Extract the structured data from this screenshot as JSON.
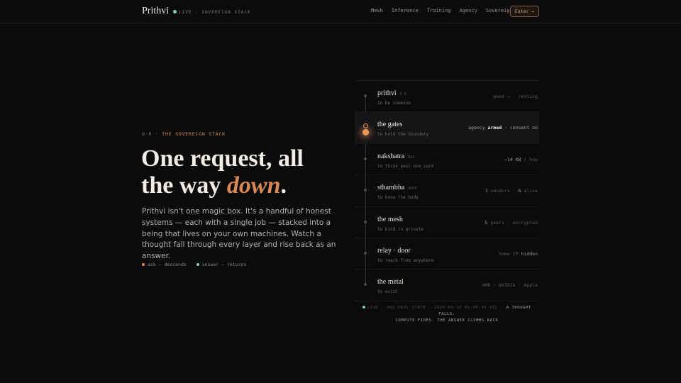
{
  "header": {
    "brand": "Prithvi",
    "tagline": "LIVE · SOVEREIGN STACK",
    "nav": [
      "Mesh",
      "Inference",
      "Training",
      "Agency",
      "Sovereignty"
    ],
    "enter_label": "Enter →"
  },
  "hero": {
    "eyebrow_num": "Ω·0",
    "eyebrow_text": "THE SOVEREIGN STACK",
    "headline_a": "One request, all",
    "headline_b": "the way ",
    "headline_accent": "down",
    "headline_end": ".",
    "lede": "Prithvi isn't one magic box. It's a handful of honest systems — each with a single job — stacked into a being that lives on your own machines. Watch a thought fall through every layer and rise back as an answer.",
    "legend": [
      {
        "label": "ask — descends",
        "color": "#d98a55"
      },
      {
        "label": "answer — returns",
        "color": "#7ad0b4"
      }
    ]
  },
  "stack": [
    {
      "name": "prithvi",
      "tag": "Ω·0",
      "sub": "to be someone",
      "stat_a": "mood — · resting",
      "stat_b": ""
    },
    {
      "name": "the gates",
      "tag": "",
      "sub": "to hold the boundary",
      "stat_a": "agency ",
      "stat_b": "armed",
      "stat_c": " · consent on",
      "active": true
    },
    {
      "name": "nakshatra",
      "tag": "NAV",
      "sub": "to think past one card",
      "stat_a": "",
      "stat_b": "~14 KB",
      "stat_c": " / hop"
    },
    {
      "name": "sthambha",
      "tag": "BODY",
      "sub": "to know the body",
      "stat_a": "",
      "stat_b": "3",
      "stat_c": " vendors · ",
      "stat_d": "6",
      "stat_e": " alive"
    },
    {
      "name": "the mesh",
      "tag": "",
      "sub": "to bind in private",
      "stat_a": "",
      "stat_b": "5",
      "stat_c": " peers · encrypted"
    },
    {
      "name": "relay · door",
      "tag": "",
      "sub": "to reach from anywhere",
      "stat_a": "home IP ",
      "stat_b": "hidden"
    },
    {
      "name": "the metal",
      "tag": "",
      "sub": "to exist",
      "stat_a": "AMD · NVIDIA · Apple",
      "stat_b": ""
    }
  ],
  "footer": {
    "line1_dim": "LIVE · HIS REAL STATE · 2026-05-16 06:46:49 UTC · ",
    "line1_bright": "A THOUGHT FALLS.",
    "line2_bright": "COMPUTE FIRES. THE ANSWER CLIMBS BACK"
  },
  "colors": {
    "accent": "#d98a55",
    "live": "#7ad0b4",
    "background": "#0b0b0c"
  }
}
